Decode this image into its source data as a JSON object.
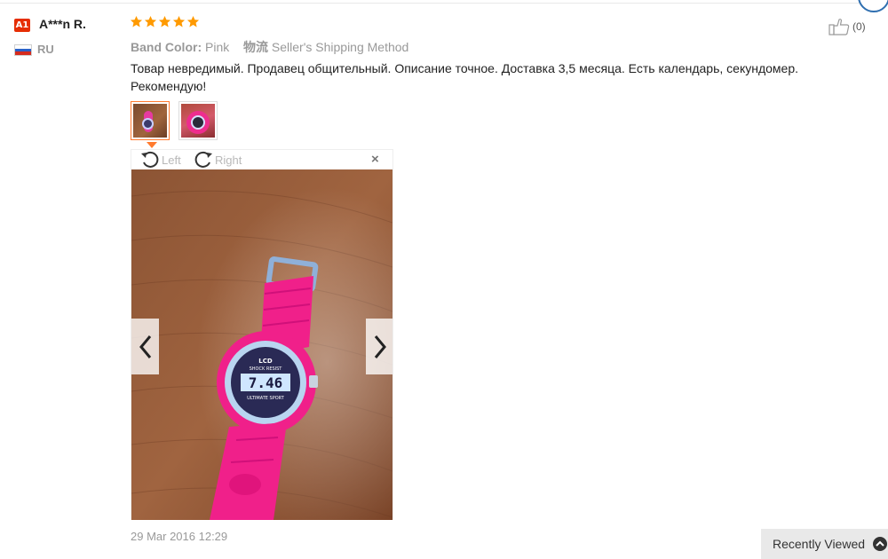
{
  "buyer": {
    "level_badge": "A1",
    "name": "A***n R.",
    "country_code": "RU"
  },
  "review": {
    "rating": 5,
    "rating_max": 5,
    "attributes": [
      {
        "key": "Band Color:",
        "value": "Pink"
      },
      {
        "key": "物流",
        "value": "Seller's Shipping Method"
      }
    ],
    "text": "Товар невредимый. Продавец общительный. Описание точное. Доставка 3,5 месяца. Есть календарь, секундомер. Рекомендую!",
    "helpful_count": "(0)",
    "date": "29 Mar 2016 12:29"
  },
  "viewer": {
    "rotate_left_label": "Left",
    "rotate_right_label": "Right",
    "close_glyph": "×",
    "watch_display": "7.46",
    "watch_brand": "LCD",
    "watch_text_top": "SHOCK RESIST",
    "watch_text_bottom": "ULTIMATE SPORT"
  },
  "footer": {
    "recently_viewed_label": "Recently Viewed"
  },
  "colors": {
    "star": "#ff9a00",
    "badge": "#e62e04",
    "accent_border": "#ff7a2e",
    "watch_pink": "#f0208a",
    "wood": "#8a5232"
  },
  "icons": [
    "star-icon",
    "thumbs-up-icon",
    "rotate-left-icon",
    "rotate-right-icon",
    "close-icon",
    "chevron-left-icon",
    "chevron-right-icon",
    "chevron-up-icon",
    "russia-flag-icon"
  ]
}
